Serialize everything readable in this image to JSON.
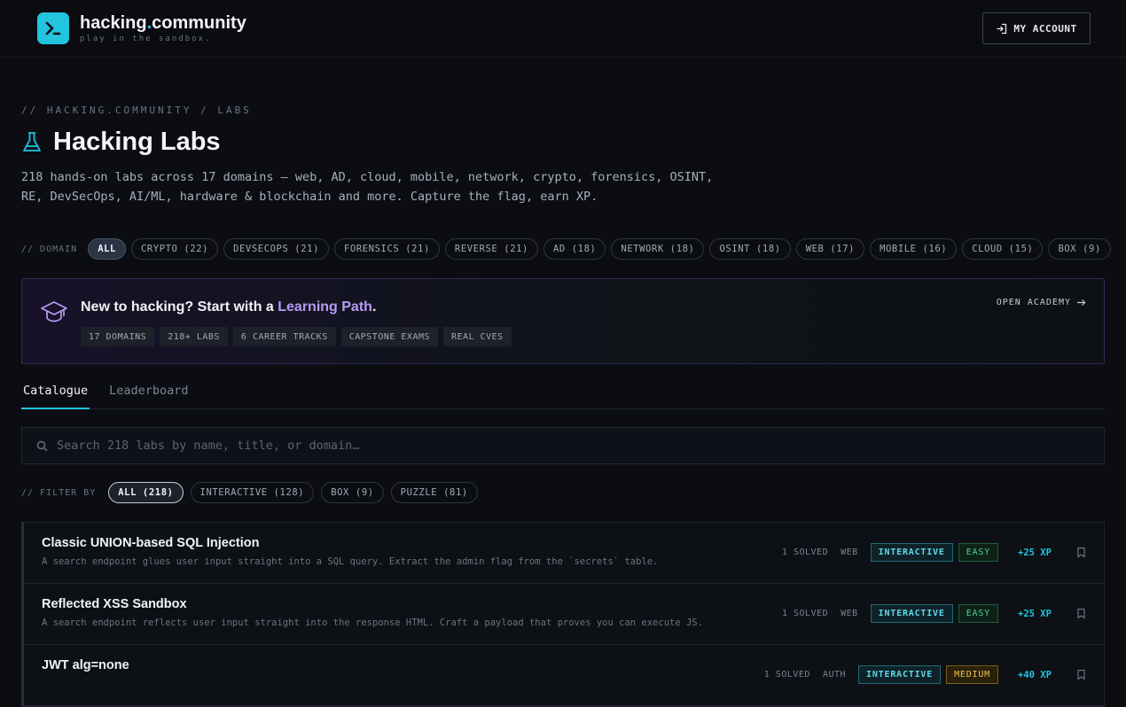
{
  "brand": {
    "name_main": "hacking",
    "name_dot": ".",
    "name_end": "community",
    "tagline": "play in the sandbox."
  },
  "header": {
    "account_label": "MY ACCOUNT"
  },
  "breadcrumb": "// HACKING.COMMUNITY / LABS",
  "page": {
    "title": "Hacking Labs",
    "intro_line1": "218 hands-on labs across 17 domains — web, AD, cloud, mobile, network, crypto, forensics, OSINT,",
    "intro_line2": "RE, DevSecOps, AI/ML, hardware & blockchain and more. Capture the flag, earn XP."
  },
  "domain_filter": {
    "label": "// DOMAIN",
    "chips": [
      {
        "label": "ALL",
        "active": true
      },
      {
        "label": "CRYPTO (22)"
      },
      {
        "label": "DEVSECOPS (21)"
      },
      {
        "label": "FORENSICS (21)"
      },
      {
        "label": "REVERSE (21)"
      },
      {
        "label": "AD (18)"
      },
      {
        "label": "NETWORK (18)"
      },
      {
        "label": "OSINT (18)"
      },
      {
        "label": "WEB (17)"
      },
      {
        "label": "MOBILE (16)"
      },
      {
        "label": "CLOUD (15)"
      },
      {
        "label": "BOX (9)"
      }
    ]
  },
  "banner": {
    "title_pre": "New to hacking? Start with a ",
    "title_link": "Learning Path",
    "title_post": ".",
    "tags": [
      "17 DOMAINS",
      "218+ LABS",
      "6 CAREER TRACKS",
      "CAPSTONE EXAMS",
      "REAL CVES"
    ],
    "cta": "OPEN ACADEMY"
  },
  "tabs": [
    {
      "label": "Catalogue",
      "active": true
    },
    {
      "label": "Leaderboard"
    }
  ],
  "search": {
    "placeholder": "Search 218 labs by name, title, or domain…",
    "value": ""
  },
  "type_filter": {
    "label": "// FILTER BY",
    "chips": [
      {
        "label": "ALL (218)",
        "active": true
      },
      {
        "label": "INTERACTIVE (128)"
      },
      {
        "label": "BOX (9)"
      },
      {
        "label": "PUZZLE (81)"
      }
    ]
  },
  "labs": [
    {
      "title": "Classic UNION-based SQL Injection",
      "desc": "A search endpoint glues user input straight into a SQL query. Extract the admin flag from the `secrets` table.",
      "solved": "1 SOLVED",
      "domain": "WEB",
      "type": "INTERACTIVE",
      "difficulty": "EASY",
      "xp": "+25 XP"
    },
    {
      "title": "Reflected XSS Sandbox",
      "desc": "A search endpoint reflects user input straight into the response HTML. Craft a payload that proves you can execute JS.",
      "solved": "1 SOLVED",
      "domain": "WEB",
      "type": "INTERACTIVE",
      "difficulty": "EASY",
      "xp": "+25 XP"
    },
    {
      "title": "JWT alg=none",
      "desc": "",
      "solved": "1 SOLVED",
      "domain": "AUTH",
      "type": "INTERACTIVE",
      "difficulty": "MEDIUM",
      "xp": "+40 XP"
    }
  ],
  "colors": {
    "accent": "#22c4e0",
    "purple": "#b79cf5",
    "easy": "#4ad38a",
    "medium": "#f0c14b"
  }
}
